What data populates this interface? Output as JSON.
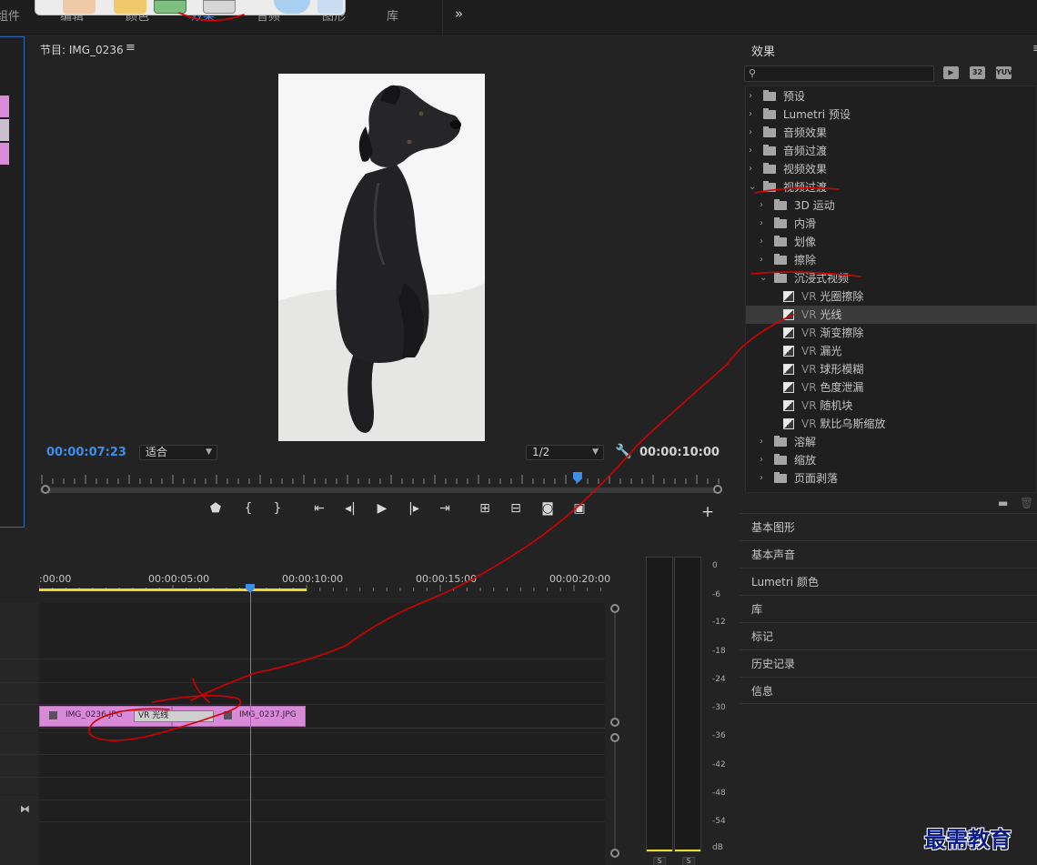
{
  "workspace": {
    "tabs": [
      "组件",
      "编辑",
      "颜色",
      "效果",
      "音频",
      "图形",
      "库"
    ],
    "more_label": "»"
  },
  "program": {
    "title": "节目: IMG_0236",
    "menu_icon": "≡",
    "timecode_current": "00:00:07:23",
    "fit_label": "适合",
    "resolution_label": "1/2",
    "timecode_duration": "00:00:10:00",
    "playhead_position": 0.79,
    "controls": [
      "marker-icon",
      "in-point-icon",
      "out-point-icon",
      "go-to-in-icon",
      "step-back-icon",
      "play-icon",
      "step-forward-icon",
      "go-to-out-icon",
      "lift-icon",
      "extract-icon",
      "camera-icon",
      "compare-icon",
      "add-icon"
    ]
  },
  "timeline": {
    "ruler_times": [
      ":00:00",
      "00:00:05:00",
      "00:00:10:00",
      "00:00:15:00",
      "00:00:20:00"
    ],
    "clips": [
      {
        "name": "IMG_0236.JPG"
      },
      {
        "name": "IMG_0237.JPG"
      }
    ],
    "transition_label": "VR 光线"
  },
  "meter": {
    "db_labels": [
      "0",
      "-6",
      "-12",
      "-18",
      "-24",
      "-30",
      "-36",
      "-42",
      "-48",
      "-54",
      "dB"
    ],
    "solo_labels": [
      "S",
      "S"
    ]
  },
  "effects": {
    "title": "效果",
    "search_placeholder": "",
    "toolbar_icons": [
      "accelerated-icon",
      "32-bit-icon",
      "yuv-icon"
    ],
    "items": [
      {
        "level": 0,
        "type": "folder-star",
        "label": "预设",
        "expanded": false
      },
      {
        "level": 0,
        "type": "folder-star",
        "label": "Lumetri 预设",
        "expanded": false
      },
      {
        "level": 0,
        "type": "folder",
        "label": "音频效果",
        "expanded": false
      },
      {
        "level": 0,
        "type": "folder",
        "label": "音频过渡",
        "expanded": false
      },
      {
        "level": 0,
        "type": "folder",
        "label": "视频效果",
        "expanded": false
      },
      {
        "level": 0,
        "type": "folder",
        "label": "视频过渡",
        "expanded": true
      },
      {
        "level": 1,
        "type": "folder",
        "label": "3D 运动",
        "expanded": false
      },
      {
        "level": 1,
        "type": "folder",
        "label": "内滑",
        "expanded": false
      },
      {
        "level": 1,
        "type": "folder",
        "label": "划像",
        "expanded": false
      },
      {
        "level": 1,
        "type": "folder",
        "label": "擦除",
        "expanded": false
      },
      {
        "level": 1,
        "type": "folder",
        "label": "沉浸式视频",
        "expanded": true
      },
      {
        "level": 2,
        "type": "effect",
        "pre": "VR",
        "label": "光圈擦除"
      },
      {
        "level": 2,
        "type": "effect",
        "pre": "VR",
        "label": "光线",
        "selected": true
      },
      {
        "level": 2,
        "type": "effect",
        "pre": "VR",
        "label": "渐变擦除"
      },
      {
        "level": 2,
        "type": "effect",
        "pre": "VR",
        "label": "漏光"
      },
      {
        "level": 2,
        "type": "effect",
        "pre": "VR",
        "label": "球形模糊"
      },
      {
        "level": 2,
        "type": "effect",
        "pre": "VR",
        "label": "色度泄漏"
      },
      {
        "level": 2,
        "type": "effect",
        "pre": "VR",
        "label": "随机块"
      },
      {
        "level": 2,
        "type": "effect",
        "pre": "VR",
        "label": "默比乌斯缩放"
      },
      {
        "level": 1,
        "type": "folder",
        "label": "溶解",
        "expanded": false
      },
      {
        "level": 1,
        "type": "folder",
        "label": "缩放",
        "expanded": false
      },
      {
        "level": 1,
        "type": "folder",
        "label": "页面剥落",
        "expanded": false
      }
    ]
  },
  "side_panels": [
    "基本图形",
    "基本声音",
    "Lumetri 颜色",
    "库",
    "标记",
    "历史记录",
    "信息"
  ],
  "watermark": "最需教育",
  "colors": {
    "accent_blue": "#3d8ee8",
    "clip_pink": "#d88ad8",
    "annotation_red": "#d40000",
    "timeline_yellow": "#e8dd2a"
  }
}
